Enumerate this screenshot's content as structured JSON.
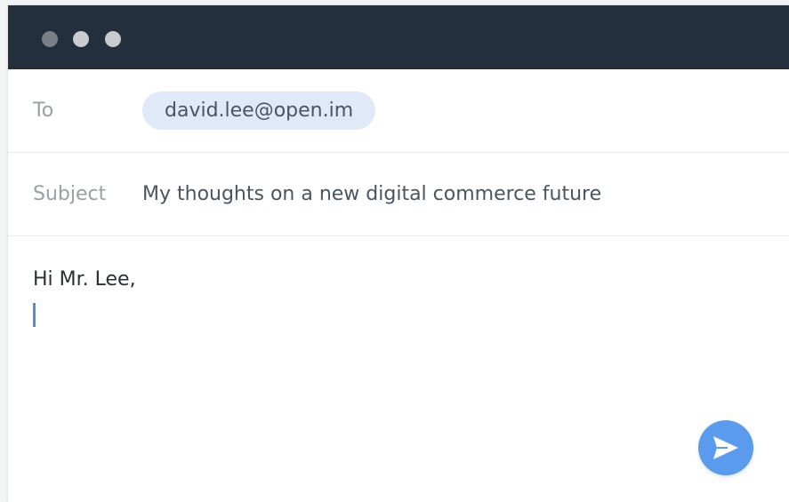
{
  "window": {
    "controls": [
      "close",
      "minimize",
      "maximize"
    ]
  },
  "compose": {
    "to": {
      "label": "To",
      "recipient": "david.lee@open.im"
    },
    "subject": {
      "label": "Subject",
      "value": "My thoughts on a new digital commerce future"
    },
    "body": {
      "text": "Hi Mr. Lee,"
    },
    "send": {
      "icon": "send-icon"
    }
  },
  "colors": {
    "titlebar": "#232f3d",
    "chip_background": "#dfe9f8",
    "accent": "#5a9bee",
    "cursor": "#4a90e2"
  }
}
